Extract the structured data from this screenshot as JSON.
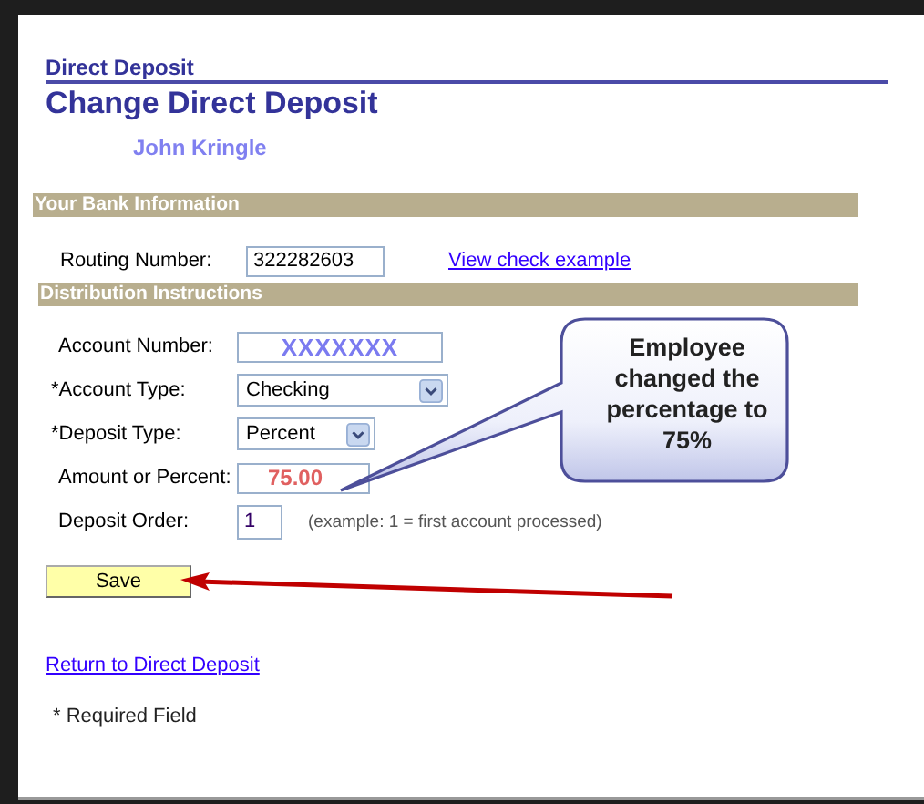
{
  "page": {
    "breadcrumb": "Direct Deposit",
    "title": "Change Direct Deposit",
    "employee": "John Kringle"
  },
  "sections": [
    {
      "title": "Your Bank Information",
      "rows": [
        {
          "kind": "text",
          "label": "Routing Number:",
          "value": "322282603",
          "link": "View check example"
        }
      ]
    },
    {
      "title": "Distribution Instructions",
      "rows": [
        {
          "kind": "masked",
          "label": "Account Number:",
          "value": "XXXXXXX"
        },
        {
          "kind": "select",
          "label": "*Account Type:",
          "value": "Checking"
        },
        {
          "kind": "select",
          "label": "*Deposit Type:",
          "value": "Percent"
        },
        {
          "kind": "emphasized",
          "label": "Amount or Percent:",
          "value": "75.00"
        },
        {
          "kind": "text",
          "label": "Deposit Order:",
          "value": "1",
          "hint": "(example: 1 = first account processed)"
        }
      ]
    }
  ],
  "save_button": "Save",
  "return_link": "Return to Direct Deposit",
  "footnote": "* Required Field",
  "callout": {
    "text": "Employee changed the percentage to 75%"
  }
}
